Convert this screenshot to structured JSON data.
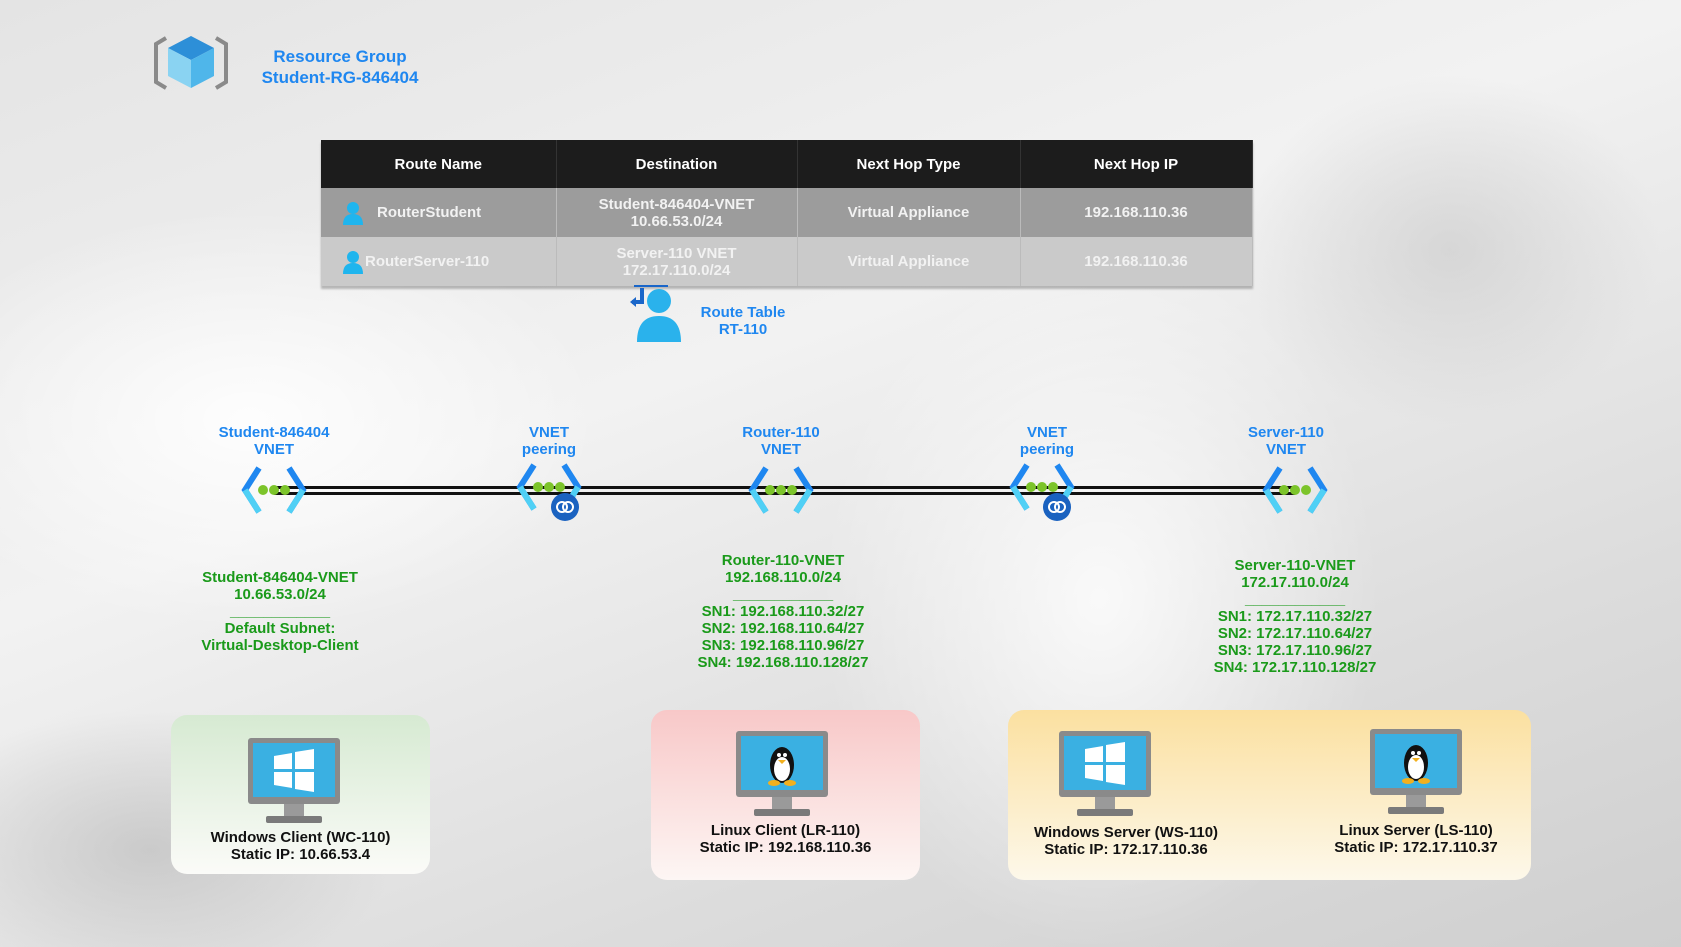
{
  "resource_group": {
    "line1": "Resource Group",
    "line2": "Student-RG-846404",
    "icon": "resource-group-cube-icon"
  },
  "route_table": {
    "columns": [
      "Route Name",
      "Destination",
      "Next Hop Type",
      "Next Hop IP"
    ],
    "rows": [
      {
        "name": "RouterStudent",
        "dest1": "Student-846404-VNET",
        "dest2": "10.66.53.0/24",
        "hop_type": "Virtual Appliance",
        "hop_ip": "192.168.110.36"
      },
      {
        "name": "RouterServer-110",
        "dest1": "Server-110 VNET",
        "dest2": "172.17.110.0/24",
        "hop_type": "Virtual Appliance",
        "hop_ip": "192.168.110.36"
      }
    ],
    "label1": "Route Table",
    "label2": "RT-110"
  },
  "vnets": [
    {
      "l1": "Student-846404",
      "l2": "VNET"
    },
    {
      "l1": "VNET",
      "l2": "peering"
    },
    {
      "l1": "Router-110",
      "l2": "VNET"
    },
    {
      "l1": "VNET",
      "l2": "peering"
    },
    {
      "l1": "Server-110",
      "l2": "VNET"
    }
  ],
  "details": {
    "student": {
      "name": "Student-846404-VNET",
      "cidr": "10.66.53.0/24",
      "divider": "____________",
      "s1": "Default Subnet:",
      "s2": "Virtual-Desktop-Client"
    },
    "router": {
      "name": "Router-110-VNET",
      "cidr": "192.168.110.0/24",
      "divider": "____________",
      "subnets": [
        "SN1: 192.168.110.32/27",
        "SN2: 192.168.110.64/27",
        "SN3: 192.168.110.96/27",
        "SN4: 192.168.110.128/27"
      ]
    },
    "server": {
      "name": "Server-110-VNET",
      "cidr": "172.17.110.0/24",
      "divider": "____________",
      "subnets": [
        "SN1: 172.17.110.32/27",
        "SN2: 172.17.110.64/27",
        "SN3: 172.17.110.96/27",
        "SN4: 172.17.110.128/27"
      ]
    }
  },
  "machines": [
    {
      "name": "Windows Client (WC-110)",
      "ip": "Static IP: 10.66.53.4",
      "os": "windows"
    },
    {
      "name": "Linux Client (LR-110)",
      "ip": "Static IP: 192.168.110.36",
      "os": "linux"
    },
    {
      "name": "Windows Server (WS-110)",
      "ip": "Static IP: 172.17.110.36",
      "os": "windows"
    },
    {
      "name": "Linux Server (LS-110)",
      "ip": "Static IP: 172.17.110.37",
      "os": "linux"
    }
  ],
  "colors": {
    "label_blue": "#1f87f0",
    "label_green": "#1a9a1a",
    "client_box": "#d9ecd6",
    "linux_box": "#f9cfcf",
    "server_box": "#fbe3a6"
  }
}
